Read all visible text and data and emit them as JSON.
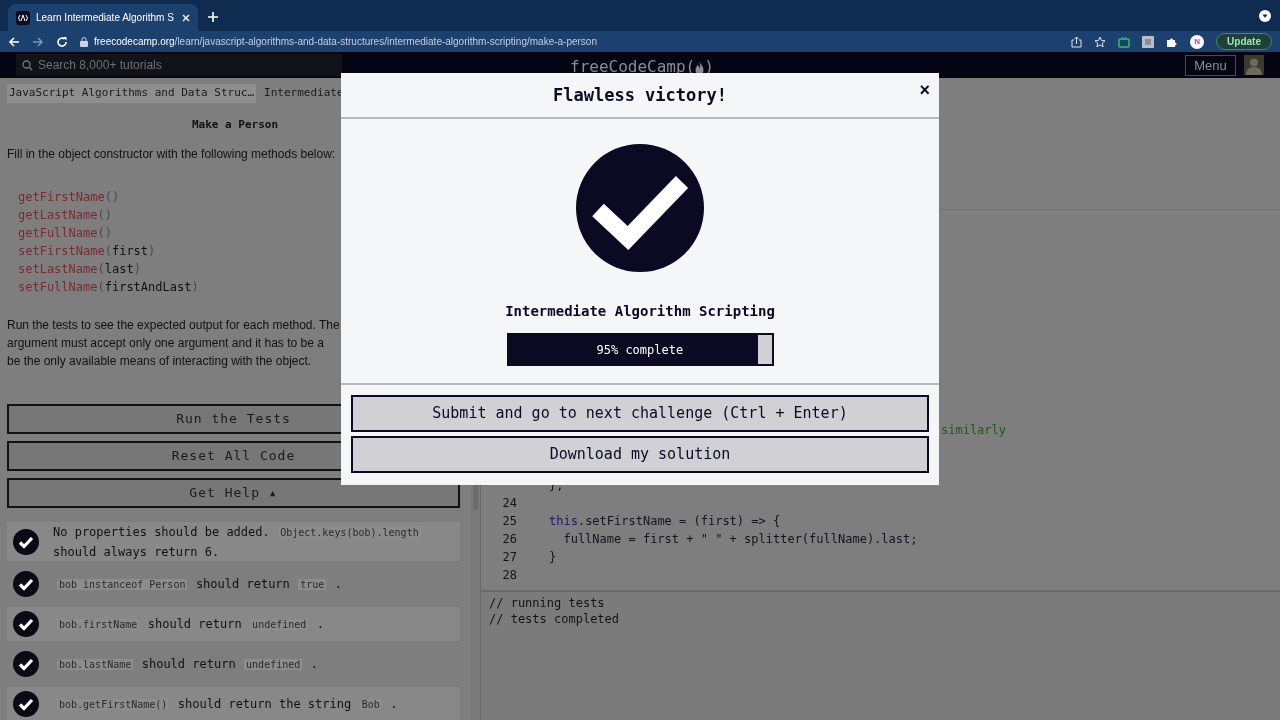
{
  "browser": {
    "tab": {
      "title": "Learn Intermediate Algorithm S",
      "selected": true
    },
    "url": "**freecodecamp.org**/learn/javascript-algorithms-and-data-structures/intermediate-algorithm-scripting/make-a-person",
    "update_button": "Update",
    "profile_initial": "N"
  },
  "nav": {
    "search_placeholder": "Search 8,000+ tutorials",
    "logo_text": "freeCodeCamp",
    "logo_open": "(",
    "logo_close": ")",
    "menu": "Menu"
  },
  "lesson": {
    "breadcrumbs": [
      {
        "label": "JavaScript Algorithms and Data Struc…"
      },
      {
        "label": "Intermediate"
      }
    ],
    "title": "Make a Person",
    "intro": "Fill in the object constructor with the following methods below:",
    "methods": [
      [
        {
          "kind": "fn",
          "s": "getFirstName"
        },
        {
          "kind": "p",
          "s": "()"
        }
      ],
      [
        {
          "kind": "fn",
          "s": "getLastName"
        },
        {
          "kind": "p",
          "s": "()"
        }
      ],
      [
        {
          "kind": "fn",
          "s": "getFullName"
        },
        {
          "kind": "p",
          "s": "()"
        }
      ],
      [
        {
          "kind": "fn",
          "s": "setFirstName"
        },
        {
          "kind": "p",
          "s": "("
        },
        {
          "kind": "arg",
          "s": "first"
        },
        {
          "kind": "p",
          "s": ")"
        }
      ],
      [
        {
          "kind": "fn",
          "s": "setLastName"
        },
        {
          "kind": "p",
          "s": "("
        },
        {
          "kind": "arg",
          "s": "last"
        },
        {
          "kind": "p",
          "s": ")"
        }
      ],
      [
        {
          "kind": "fn",
          "s": "setFullName"
        },
        {
          "kind": "p",
          "s": "("
        },
        {
          "kind": "arg",
          "s": "firstAndLast"
        },
        {
          "kind": "p",
          "s": ")"
        }
      ]
    ],
    "instructions": [
      "Run the tests to see the expected output for each method. The",
      "argument must accept only one argument and it has to be a",
      "be the only available means of interacting with the object."
    ],
    "buttons": [
      "Run the Tests",
      "Reset All Code",
      "Get Help ▴"
    ],
    "tests": [
      {
        "passed": true,
        "parts": [
          {
            "kind": "text",
            "s": "No properties should be added."
          },
          {
            "kind": "code",
            "s": "Object.keys(bob).length"
          },
          {
            "kind": "text",
            "s": "should always return 6."
          }
        ]
      },
      {
        "passed": true,
        "parts": [
          {
            "kind": "code",
            "s": "bob instanceof Person"
          },
          {
            "kind": "text",
            "s": "should return"
          },
          {
            "kind": "code",
            "s": "true"
          },
          {
            "kind": "text",
            "s": "."
          }
        ]
      },
      {
        "passed": true,
        "parts": [
          {
            "kind": "code",
            "s": "bob.firstName"
          },
          {
            "kind": "text",
            "s": "should return"
          },
          {
            "kind": "code",
            "s": "undefined"
          },
          {
            "kind": "text",
            "s": "."
          }
        ]
      },
      {
        "passed": true,
        "parts": [
          {
            "kind": "code",
            "s": "bob.lastName"
          },
          {
            "kind": "text",
            "s": "should return"
          },
          {
            "kind": "code",
            "s": "undefined"
          },
          {
            "kind": "text",
            "s": "."
          }
        ]
      },
      {
        "passed": true,
        "parts": [
          {
            "kind": "code",
            "s": "bob.getFirstName()"
          },
          {
            "kind": "text",
            "s": "should return the string"
          },
          {
            "kind": "code",
            "s": "Bob"
          },
          {
            "kind": "text",
            "s": "."
          }
        ]
      }
    ]
  },
  "editor": {
    "lines": [
      {
        "kind": "tail",
        "parts": [
          {
            "kind": "comment",
            "s": "similarly"
          }
        ]
      },
      {
        "kind": "partial",
        "parts": [
          {
            "kind": "plain",
            "s": "};"
          }
        ]
      },
      {
        "kind": "line",
        "num": "24"
      },
      {
        "kind": "line",
        "num": "25",
        "parts": [
          {
            "kind": "keyword",
            "s": "this"
          },
          {
            "kind": "plain",
            "s": ".setFirstName = (first) => {"
          }
        ]
      },
      {
        "kind": "line",
        "num": "26",
        "parts": [
          {
            "kind": "plain",
            "s": "  fullName = first + \" \" + splitter(fullName).last;"
          }
        ]
      },
      {
        "kind": "line",
        "num": "27",
        "parts": [
          {
            "kind": "plain",
            "s": "}"
          }
        ]
      },
      {
        "kind": "line",
        "num": "28"
      }
    ],
    "output": [
      "// running tests",
      "// tests completed"
    ]
  },
  "modal": {
    "title": "Flawless victory!",
    "close": "×",
    "block": "Intermediate Algorithm Scripting",
    "progress": {
      "level": 0.95,
      "label": "95% complete"
    },
    "buttons": [
      "Submit and go to next challenge (Ctrl + Enter)",
      "Download my solution"
    ]
  }
}
